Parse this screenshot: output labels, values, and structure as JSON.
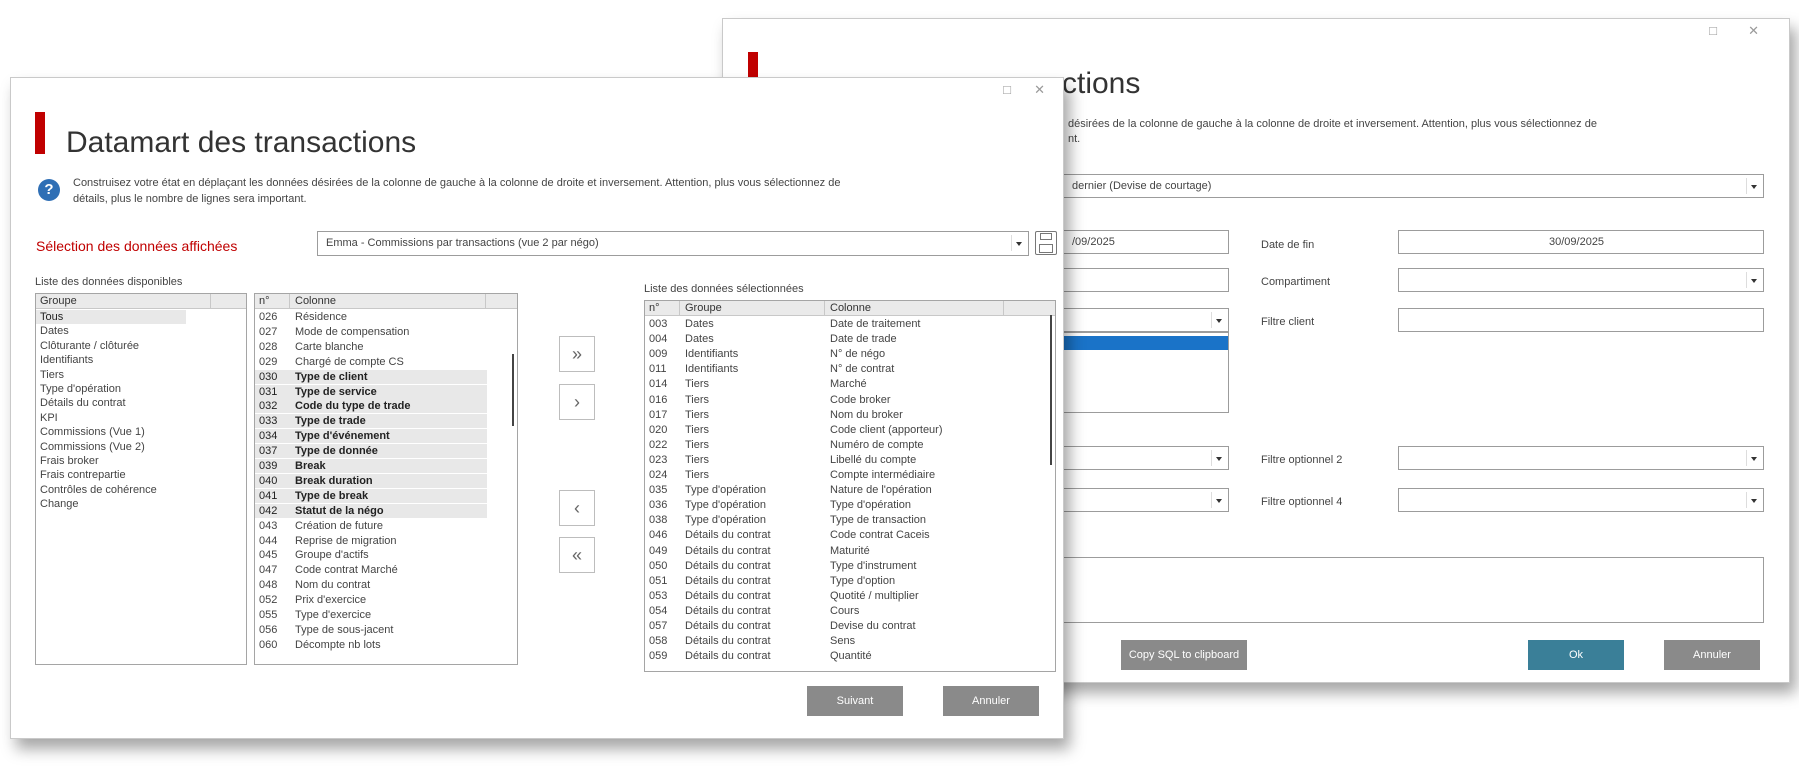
{
  "back_window": {
    "title_partial": "ctions",
    "help_text_line1": "désirées de la colonne de gauche à la colonne de droite et inversement. Attention, plus vous sélectionnez de",
    "help_text_line2": "nt.",
    "currency_select": "dernier (Devise de courtage)",
    "date_debut_value": "/09/2025",
    "date_fin_label": "Date de fin",
    "date_fin_value": "30/09/2025",
    "compartiment_label": "Compartiment",
    "filtre_client_label": "Filtre client",
    "filtre_opt2_label": "Filtre optionnel 2",
    "filtre_opt4_label": "Filtre optionnel 4",
    "copy_sql_button": "Copy SQL to clipboard",
    "ok_button": "Ok",
    "cancel_button": "Annuler"
  },
  "front_window": {
    "title": "Datamart des transactions",
    "help_text_line1": "Construisez votre état en déplaçant les données désirées de la colonne de gauche à la colonne de droite et inversement. Attention, plus vous sélectionnez de",
    "help_text_line2": "détails, plus le nombre de lignes sera important.",
    "selection_label": "Sélection des données affichées",
    "selection_value": "Emma - Commissions par transactions (vue 2 par négo)",
    "available_label": "Liste des données disponibles",
    "selected_label": "Liste des données sélectionnées",
    "groups_header": "Groupe",
    "groups": [
      "Tous",
      "Dates",
      "Clôturante / clôturée",
      "Identifiants",
      "Tiers",
      "Type d'opération",
      "Détails du contrat",
      "KPI",
      "Commissions (Vue 1)",
      "Commissions (Vue 2)",
      "Frais broker",
      "Frais contrepartie",
      "Contrôles de cohérence",
      "Change"
    ],
    "columns_header_n": "n°",
    "columns_header_col": "Colonne",
    "columns": [
      {
        "n": "026",
        "name": "Résidence",
        "sel": false
      },
      {
        "n": "027",
        "name": "Mode de compensation",
        "sel": false
      },
      {
        "n": "028",
        "name": "Carte blanche",
        "sel": false
      },
      {
        "n": "029",
        "name": "Chargé de compte CS",
        "sel": false
      },
      {
        "n": "030",
        "name": "Type de client",
        "sel": true
      },
      {
        "n": "031",
        "name": "Type de service",
        "sel": true
      },
      {
        "n": "032",
        "name": "Code du type de trade",
        "sel": true
      },
      {
        "n": "033",
        "name": "Type de trade",
        "sel": true
      },
      {
        "n": "034",
        "name": "Type d'événement",
        "sel": true
      },
      {
        "n": "037",
        "name": "Type de donnée",
        "sel": true
      },
      {
        "n": "039",
        "name": "Break",
        "sel": true
      },
      {
        "n": "040",
        "name": "Break duration",
        "sel": true
      },
      {
        "n": "041",
        "name": "Type de break",
        "sel": true
      },
      {
        "n": "042",
        "name": "Statut de la négo",
        "sel": true
      },
      {
        "n": "043",
        "name": "Création de future",
        "sel": false
      },
      {
        "n": "044",
        "name": "Reprise de migration",
        "sel": false
      },
      {
        "n": "045",
        "name": "Groupe d'actifs",
        "sel": false
      },
      {
        "n": "047",
        "name": "Code contrat Marché",
        "sel": false
      },
      {
        "n": "048",
        "name": "Nom du contrat",
        "sel": false
      },
      {
        "n": "052",
        "name": "Prix d'exercice",
        "sel": false
      },
      {
        "n": "055",
        "name": "Type d'exercice",
        "sel": false
      },
      {
        "n": "056",
        "name": "Type de sous-jacent",
        "sel": false
      },
      {
        "n": "060",
        "name": "Décompte nb lots",
        "sel": false
      }
    ],
    "selected_header_n": "n°",
    "selected_header_group": "Groupe",
    "selected_header_col": "Colonne",
    "selected": [
      {
        "n": "003",
        "g": "Dates",
        "c": "Date de traitement"
      },
      {
        "n": "004",
        "g": "Dates",
        "c": "Date de trade"
      },
      {
        "n": "009",
        "g": "Identifiants",
        "c": "N° de négo"
      },
      {
        "n": "011",
        "g": "Identifiants",
        "c": "N° de contrat"
      },
      {
        "n": "014",
        "g": "Tiers",
        "c": "Marché"
      },
      {
        "n": "016",
        "g": "Tiers",
        "c": "Code broker"
      },
      {
        "n": "017",
        "g": "Tiers",
        "c": "Nom du broker"
      },
      {
        "n": "020",
        "g": "Tiers",
        "c": "Code client (apporteur)"
      },
      {
        "n": "022",
        "g": "Tiers",
        "c": "Numéro de compte"
      },
      {
        "n": "023",
        "g": "Tiers",
        "c": "Libellé du compte"
      },
      {
        "n": "024",
        "g": "Tiers",
        "c": "Compte intermédiaire"
      },
      {
        "n": "035",
        "g": "Type d'opération",
        "c": "Nature de l'opération"
      },
      {
        "n": "036",
        "g": "Type d'opération",
        "c": "Type d'opération"
      },
      {
        "n": "038",
        "g": "Type d'opération",
        "c": "Type de transaction"
      },
      {
        "n": "046",
        "g": "Détails du contrat",
        "c": "Code contrat Caceis"
      },
      {
        "n": "049",
        "g": "Détails du contrat",
        "c": "Maturité"
      },
      {
        "n": "050",
        "g": "Détails du contrat",
        "c": "Type d'instrument"
      },
      {
        "n": "051",
        "g": "Détails du contrat",
        "c": "Type d'option"
      },
      {
        "n": "053",
        "g": "Détails du contrat",
        "c": "Quotité / multiplier"
      },
      {
        "n": "054",
        "g": "Détails du contrat",
        "c": "Cours"
      },
      {
        "n": "057",
        "g": "Détails du contrat",
        "c": "Devise du contrat"
      },
      {
        "n": "058",
        "g": "Détails du contrat",
        "c": "Sens"
      },
      {
        "n": "059",
        "g": "Détails du contrat",
        "c": "Quantité"
      }
    ],
    "btn_add_all": "»",
    "btn_add": "›",
    "btn_remove": "‹",
    "btn_remove_all": "«",
    "next_button": "Suivant",
    "cancel_button": "Annuler"
  }
}
